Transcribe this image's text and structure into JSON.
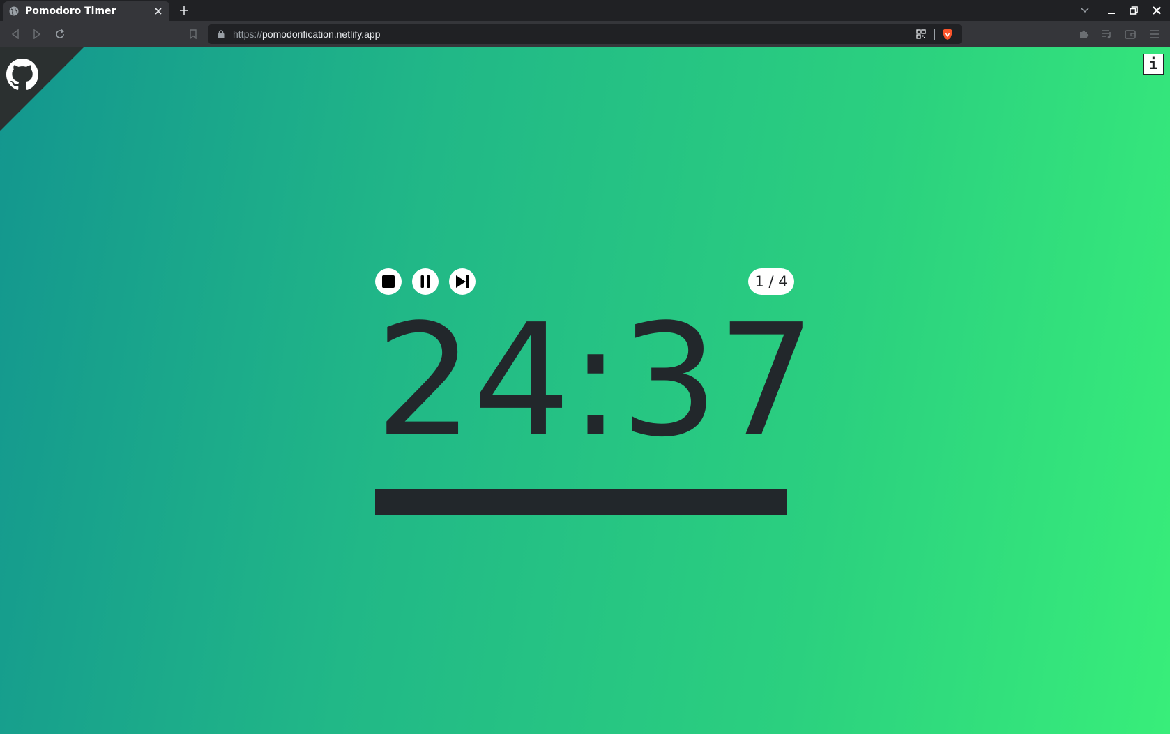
{
  "browser": {
    "tab_title": "Pomodoro Timer",
    "url_scheme": "https://",
    "url_host": "pomodorification.netlify.app",
    "icons": [
      "globe-icon",
      "close-icon",
      "plus-icon",
      "chevron-down-icon",
      "minimize-icon",
      "restore-icon",
      "close-window-icon",
      "back-icon",
      "forward-icon",
      "reload-icon",
      "bookmark-icon",
      "lock-icon",
      "qr-code-icon",
      "brave-lion-icon",
      "extensions-icon",
      "playlist-icon",
      "wallet-icon",
      "menu-icon"
    ]
  },
  "page": {
    "github_icon": "github-octocat-icon",
    "info_label": "i",
    "controls": [
      "stop-icon",
      "pause-icon",
      "skip-next-icon"
    ],
    "round": "1 / 4",
    "time": "24:37",
    "progress_fraction": 1.0
  },
  "colors": {
    "gradient_start": "#13968f",
    "gradient_end": "#38ee7a",
    "timer_text": "#22272b",
    "brave_orange": "#fb542b"
  }
}
